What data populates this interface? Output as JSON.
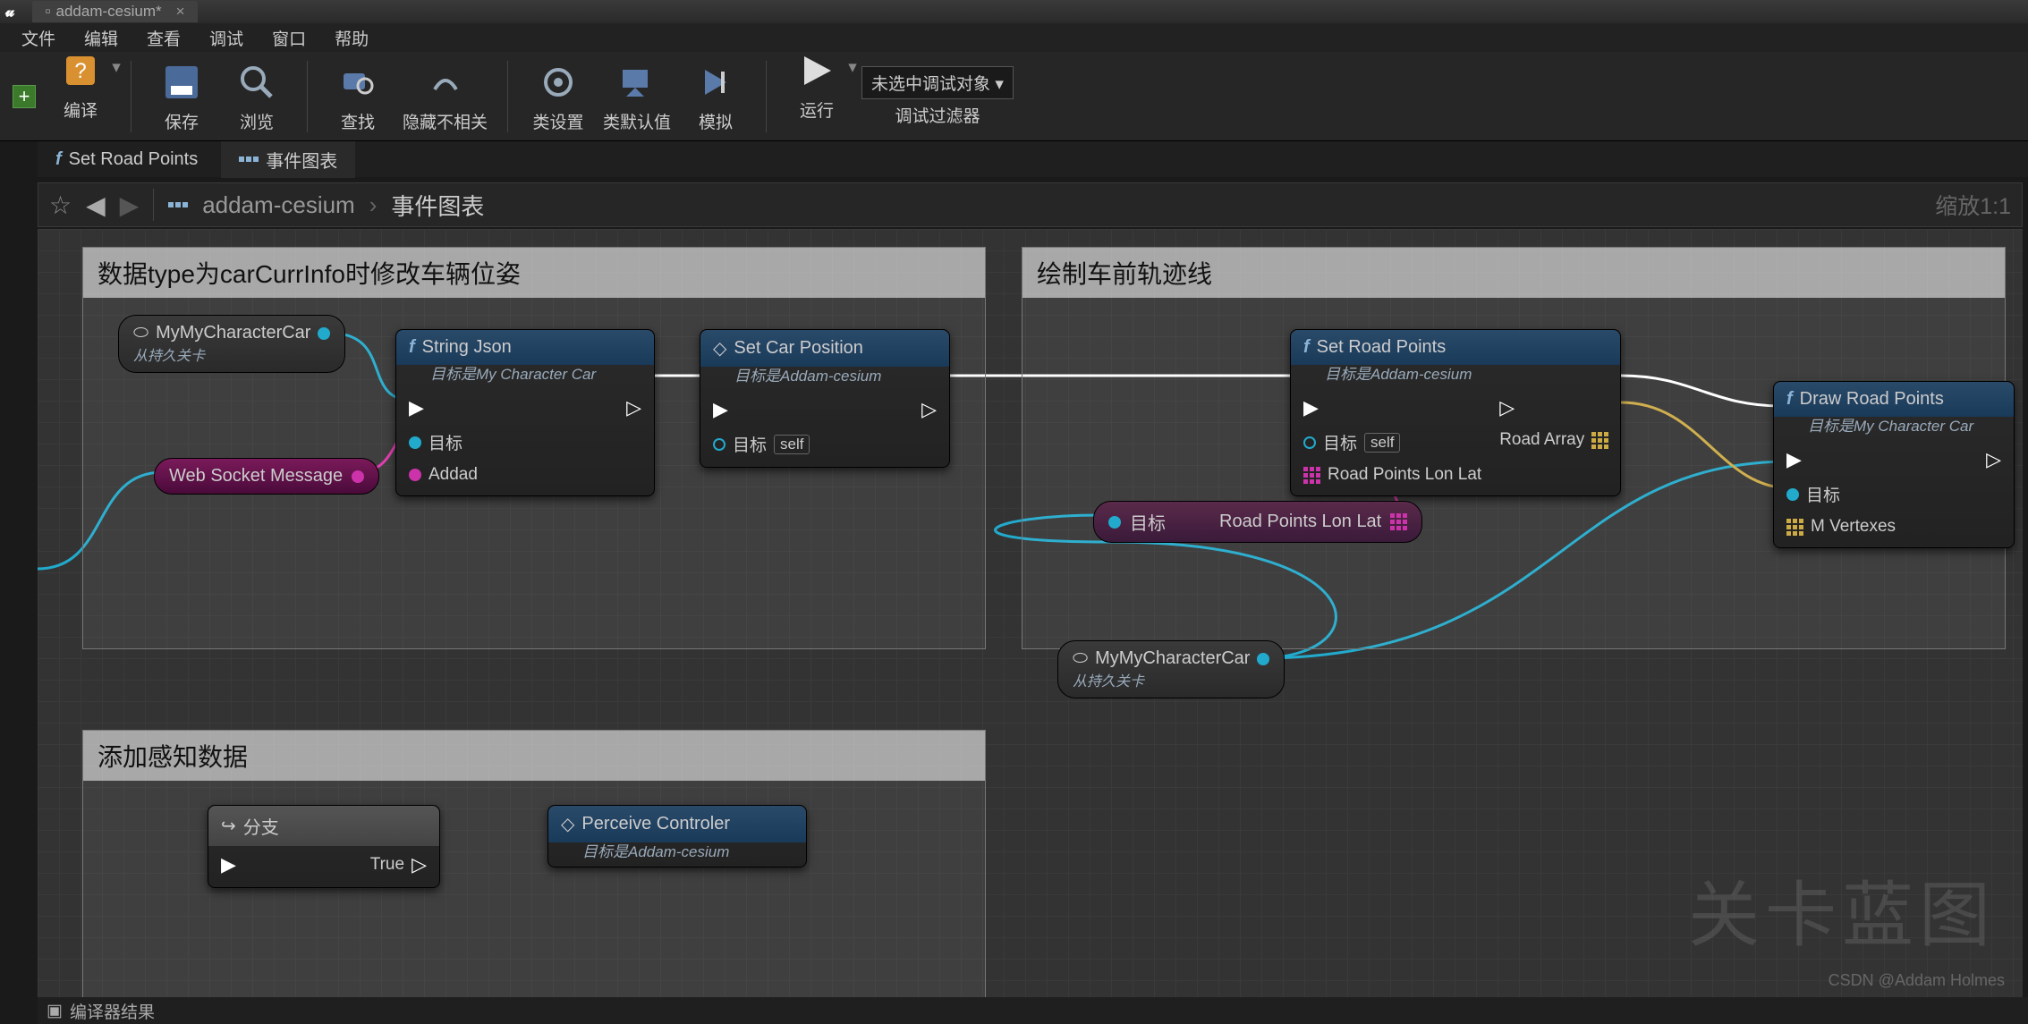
{
  "titlebar": {
    "tab": "addam-cesium*"
  },
  "menubar": [
    "文件",
    "编辑",
    "查看",
    "调试",
    "窗口",
    "帮助"
  ],
  "toolbar": {
    "items": [
      "编译",
      "保存",
      "浏览",
      "查找",
      "隐藏不相关",
      "类设置",
      "类默认值",
      "模拟",
      "运行"
    ],
    "debug_selector": "未选中调试对象",
    "debug_label": "调试过滤器"
  },
  "subtabs": {
    "tab1": "Set Road Points",
    "tab2": "事件图表"
  },
  "breadcrumb": {
    "root": "addam-cesium",
    "leaf": "事件图表",
    "zoom": "缩放1:1"
  },
  "comments": {
    "c1": "数据type为carCurrInfo时修改车辆位姿",
    "c2": "绘制车前轨迹线",
    "c3": "添加感知数据"
  },
  "nodes": {
    "varCar1": {
      "title": "MyMyCharacterCar",
      "sub": "从持久关卡"
    },
    "stringJson": {
      "title": "String Json",
      "sub": "目标是My Character Car",
      "pin_target": "目标",
      "pin_addad": "Addad"
    },
    "setCarPos": {
      "title": "Set Car Position",
      "sub": "目标是Addam-cesium",
      "pin_target": "目标",
      "self": "self"
    },
    "wsMsg": {
      "title": "Web Socket Message"
    },
    "setRoad": {
      "title": "Set Road Points",
      "sub": "目标是Addam-cesium",
      "pin_target": "目标",
      "self": "self",
      "pin_roadpts": "Road Points Lon Lat",
      "out_array": "Road Array"
    },
    "drawRoad": {
      "title": "Draw Road Points",
      "sub": "目标是My Character Car",
      "pin_target": "目标",
      "pin_verts": "M Vertexes"
    },
    "reroute": {
      "pin_target": "目标",
      "pin_roadpts": "Road Points Lon Lat"
    },
    "varCar2": {
      "title": "MyMyCharacterCar",
      "sub": "从持久关卡"
    },
    "branch": {
      "title": "分支",
      "true": "True"
    },
    "perceive": {
      "title": "Perceive Controler",
      "sub": "目标是Addam-cesium"
    }
  },
  "watermark": "关卡蓝图",
  "credit": "CSDN @Addam Holmes",
  "bottombar": "编译器结果"
}
